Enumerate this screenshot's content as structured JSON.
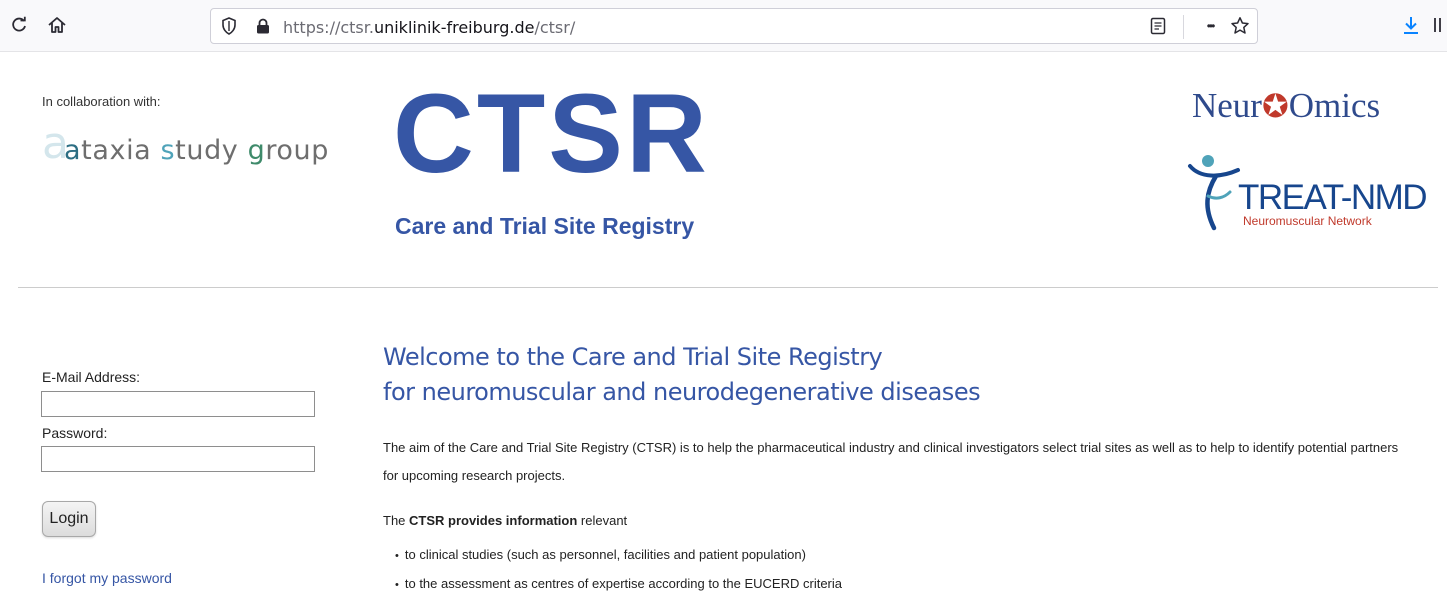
{
  "browser": {
    "url_prefix": "https://ctsr.",
    "url_domain": "uniklinik-freiburg.de",
    "url_path": "/ctsr/",
    "icons": [
      "reload-icon",
      "home-icon",
      "shield-icon",
      "lock-icon",
      "reader-view-icon",
      "more-icon",
      "bookmark-star-icon",
      "download-icon",
      "library-icon"
    ],
    "more_glyph": "•••"
  },
  "header": {
    "collab_label": "In collaboration with:",
    "ataxia_logo": {
      "big_letter": "a",
      "text": "ataxia study group"
    },
    "ctsr_title": "CTSR",
    "ctsr_subtitle": "Care and Trial Site Registry",
    "neuromics_logo": "NeurOmics",
    "treat_nmd_logo": {
      "name": "TREAT-NMD",
      "tagline": "Neuromuscular Network"
    }
  },
  "login": {
    "email_label": "E-Mail Address:",
    "email_value": "",
    "password_label": "Password:",
    "password_value": "",
    "login_button": "Login",
    "forgot_link": "I forgot my password"
  },
  "main": {
    "welcome_line1": "Welcome to the Care and Trial Site Registry",
    "welcome_line2": "for neuromuscular and neurodegenerative diseases",
    "intro_paragraph": "The aim of the Care and Trial Site Registry (CTSR) is to help the pharmaceutical industry and clinical investigators select trial sites as well as to help to identify potential partners for upcoming research projects.",
    "provides_prefix": "The ",
    "provides_bold": "CTSR provides information",
    "provides_suffix": " relevant",
    "bullets": [
      "to clinical studies (such as personnel, facilities and patient population)",
      "to the assessment as centres of expertise according to the EUCERD criteria"
    ]
  },
  "colors": {
    "brand_blue": "#3656a5",
    "link_blue": "#3656a5",
    "neuromics_blue": "#2f4a8c",
    "treat_red": "#c0392b"
  }
}
